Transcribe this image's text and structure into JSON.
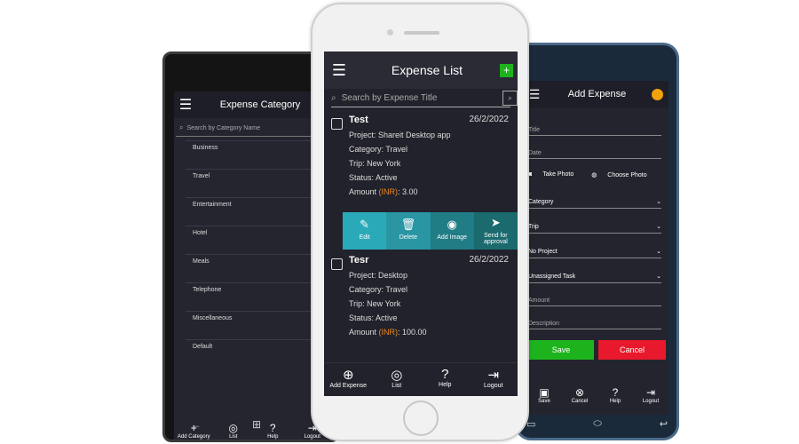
{
  "colors": {
    "green": "#1db31d",
    "teal": "#2aaab8",
    "darkteal": "#1a6a6e",
    "red": "#e8192c",
    "inr": "#f08a1f"
  },
  "left": {
    "title": "Expense Category",
    "search_placeholder": "Search by Category Name",
    "categories": [
      "Business",
      "Travel",
      "Entertainment",
      "Hotel",
      "Meals",
      "Telephone",
      "Miscellaneous",
      "Default"
    ],
    "footer": [
      {
        "icon": "add-icon",
        "glyph": "+",
        "label": "Add Category"
      },
      {
        "icon": "user-icon",
        "glyph": "◎",
        "label": "List"
      },
      {
        "icon": "help-icon",
        "glyph": "?",
        "label": "Help"
      },
      {
        "icon": "logout-icon",
        "glyph": "⇥",
        "label": "Logout"
      }
    ]
  },
  "center": {
    "title": "Expense List",
    "search_placeholder": "Search by Expense Title",
    "expenses": [
      {
        "title": "Test",
        "date": "26/2/2022",
        "project": "Project: Shareit Desktop app",
        "category": "Category: Travel",
        "trip": "Trip: New York",
        "status": "Status: Active",
        "amount_prefix": "Amount ",
        "currency": "(INR)",
        "amount_value": ": 3.00"
      },
      {
        "title": "Tesr",
        "date": "26/2/2022",
        "project": "Project: Desktop",
        "category": "Category: Travel",
        "trip": "Trip: New York",
        "status": "Status: Active",
        "amount_prefix": "Amount ",
        "currency": "(INR)",
        "amount_value": ": 100.00"
      }
    ],
    "actions": [
      {
        "icon": "edit-icon",
        "glyph": "✎",
        "label": "Edit"
      },
      {
        "icon": "delete-icon",
        "glyph": "🗑",
        "label": "Delete"
      },
      {
        "icon": "camera-icon",
        "glyph": "◉",
        "label": "Add Image"
      },
      {
        "icon": "send-icon",
        "glyph": "➤",
        "label": "Send for approval"
      }
    ],
    "footer": [
      {
        "icon": "add-icon",
        "glyph": "⊕",
        "label": "Add Expense"
      },
      {
        "icon": "user-icon",
        "glyph": "◎",
        "label": "List"
      },
      {
        "icon": "help-icon",
        "glyph": "?",
        "label": "Help"
      },
      {
        "icon": "logout-icon",
        "glyph": "⇥",
        "label": "Logout"
      }
    ]
  },
  "right": {
    "title": "Add Expense",
    "title_field": "Title",
    "date_field": "Date",
    "take_photo": "Take Photo",
    "choose_photo": "Choose Photo",
    "category": "Category",
    "trip": "Trip",
    "project": "No Project",
    "task": "Unassigned Task",
    "amount": "Amount",
    "description": "Description",
    "save": "Save",
    "cancel": "Cancel",
    "footer": [
      {
        "icon": "save-icon",
        "glyph": "▣",
        "label": "Save"
      },
      {
        "icon": "cancel-icon",
        "glyph": "⊗",
        "label": "Cancel"
      },
      {
        "icon": "help-icon",
        "glyph": "?",
        "label": "Help"
      },
      {
        "icon": "logout-icon",
        "glyph": "⇥",
        "label": "Logout"
      }
    ]
  }
}
